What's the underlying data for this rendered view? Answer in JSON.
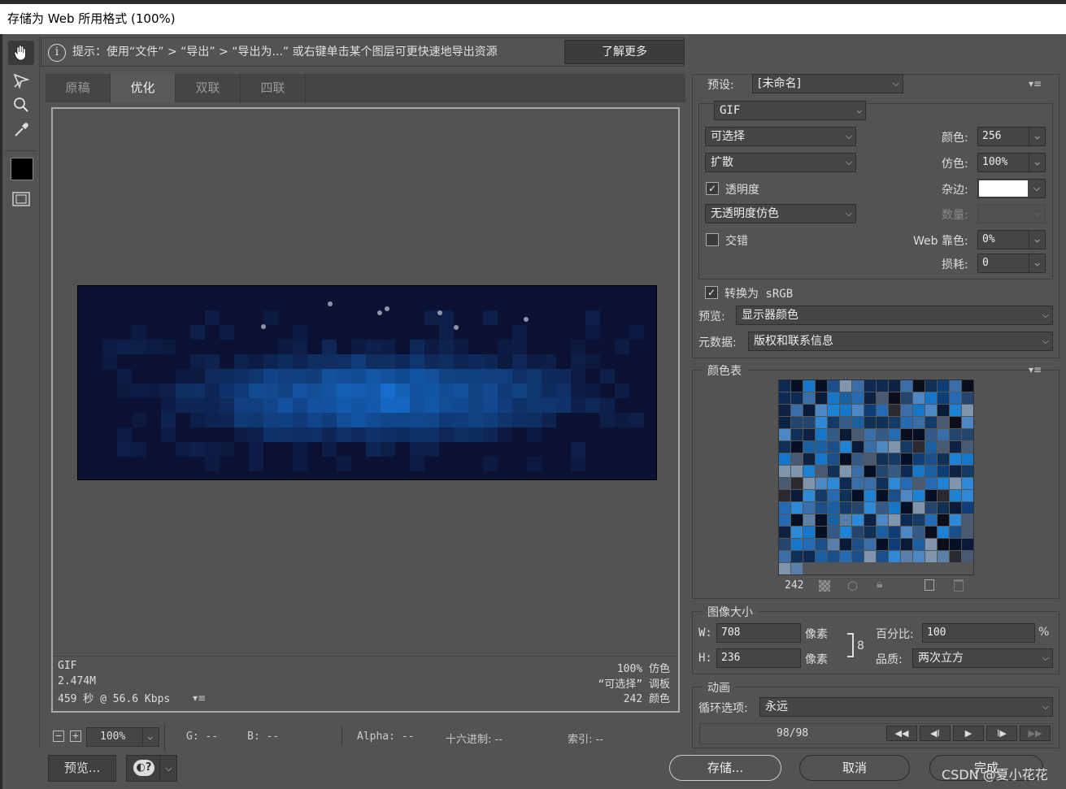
{
  "window": {
    "title": "存储为 Web 所用格式 (100%)"
  },
  "hint": {
    "text": "提示：使用“文件” > “导出” > “导出为...” 或右键单击某个图层可更快速地导出资源",
    "learn_more": "了解更多"
  },
  "tabs": [
    "原稿",
    "优化",
    "双联",
    "四联"
  ],
  "image_info": {
    "format": "GIF",
    "size": "2.474M",
    "time": "459 秒 @ 56.6 Kbps",
    "dither": "100% 仿色",
    "palette_type": "“可选择” 调板",
    "colors": "242 颜色"
  },
  "zoom": {
    "minus": "−",
    "plus": "+",
    "value": "100%"
  },
  "pixel_info": {
    "g": "G: --",
    "b": "B: --",
    "alpha": "Alpha: --",
    "hex": "十六进制: --",
    "index": "索引: --"
  },
  "buttons": {
    "preview": "预览...",
    "save": "存储...",
    "cancel": "取消",
    "done": "完成"
  },
  "preset": {
    "label": "预设:",
    "value": "[未命名]"
  },
  "settings": {
    "format": "GIF",
    "reduction": "可选择",
    "dither_algo": "扩散",
    "transparency_label": "透明度",
    "transparency_checked": true,
    "transparency_dither": "无透明度仿色",
    "interlaced_label": "交错",
    "interlaced_checked": false,
    "colors_label": "颜色:",
    "colors_value": "256",
    "dither_label": "仿色:",
    "dither_value": "100%",
    "matte_label": "杂边:",
    "matte_color": "#ffffff",
    "amount_label": "数量:",
    "web_snap_label": "Web 靠色:",
    "web_snap_value": "0%",
    "lossy_label": "损耗:",
    "lossy_value": "0",
    "convert_srgb_label": "转换为 sRGB",
    "convert_srgb_checked": true,
    "preview_label": "预览:",
    "preview_value": "显示器颜色",
    "metadata_label": "元数据:",
    "metadata_value": "版权和联系信息"
  },
  "color_table": {
    "title": "颜色表",
    "count": "242"
  },
  "image_size": {
    "title": "图像大小",
    "w_label": "W:",
    "w_value": "708",
    "w_unit": "像素",
    "h_label": "H:",
    "h_value": "236",
    "h_unit": "像素",
    "percent_label": "百分比:",
    "percent_value": "100",
    "percent_unit": "%",
    "quality_label": "品质:",
    "quality_value": "两次立方"
  },
  "animation": {
    "title": "动画",
    "loop_label": "循环选项:",
    "loop_value": "永远",
    "frame_counter": "98/98",
    "controls": [
      "◀◀",
      "◀I",
      "▶",
      "I▶",
      "▶▶"
    ]
  },
  "watermark": "CSDN @夏小花花",
  "colors": {
    "background": "#535353",
    "image_bg": "#0c1233",
    "accent_blue": "#1466b8"
  }
}
